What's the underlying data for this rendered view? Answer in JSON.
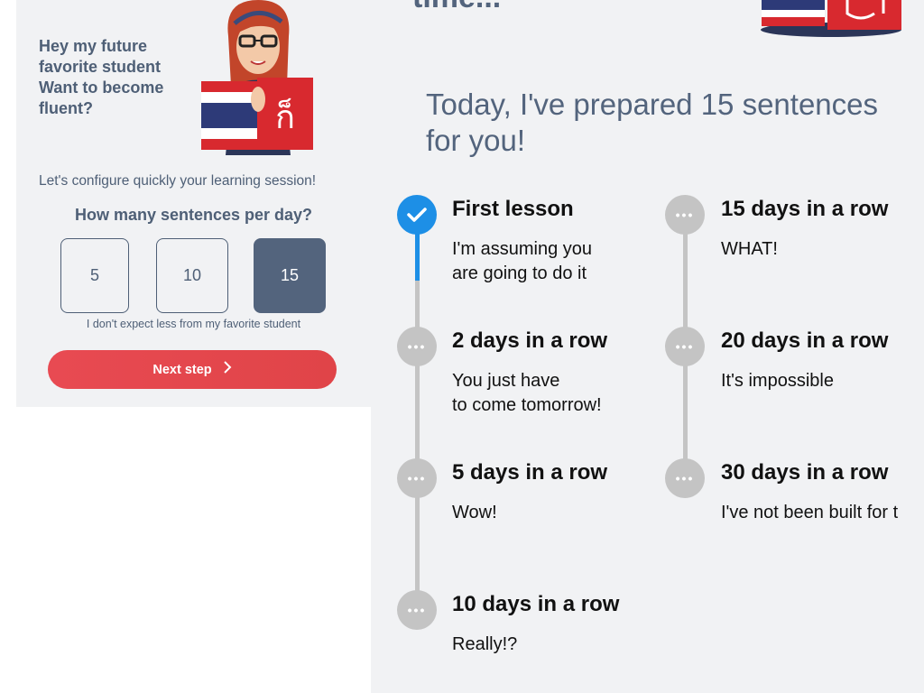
{
  "left": {
    "greeting": "Hey my future favorite student Want to become fluent?",
    "config_text": "Let's configure quickly your learning session!",
    "question": "How many sentences per day?",
    "options": [
      "5",
      "10",
      "15"
    ],
    "selected_option": "15",
    "hint": "I don't expect less from my favorite student",
    "next_label": "Next step",
    "book_glyph": "ก็"
  },
  "right": {
    "top_fragment": "time...",
    "heading": "Today, I've prepared 15 sentences for you!",
    "milestones": [
      {
        "title": "First lesson",
        "desc": "I'm assuming you\nare going to do it",
        "done": true
      },
      {
        "title": "2 days in a row",
        "desc": "You just have\nto come tomorrow!",
        "done": false
      },
      {
        "title": "5 days in a row",
        "desc": "Wow!",
        "done": false
      },
      {
        "title": "10 days in a row",
        "desc": "Really!?",
        "done": false
      },
      {
        "title": "15 days in a row",
        "desc": "WHAT!",
        "done": false
      },
      {
        "title": "20 days in a row",
        "desc": "It's impossible",
        "done": false
      },
      {
        "title": "30 days in a row",
        "desc": "I've not been built for t",
        "done": false
      }
    ]
  },
  "colors": {
    "text": "#4e5f76",
    "accent_red": "#e2464d",
    "progress_blue": "#1d8fe6",
    "inactive_gray": "#c4c4c4",
    "background": "#f1f2f4"
  },
  "icons": {
    "check": "check-icon",
    "dots": "ellipsis-icon",
    "chevron": "chevron-right-icon"
  }
}
